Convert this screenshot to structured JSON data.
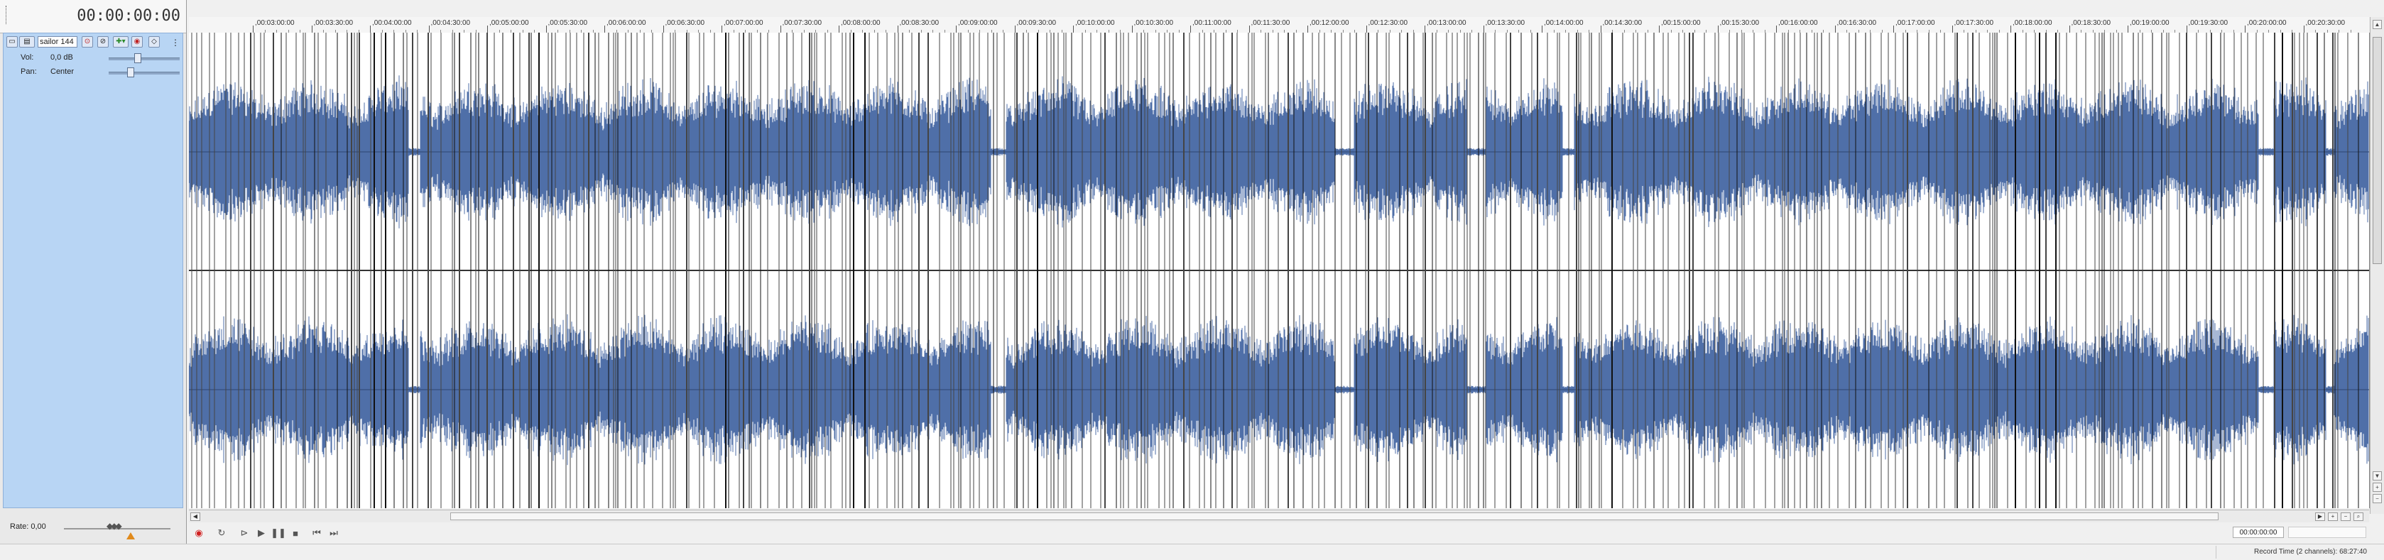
{
  "transport_time": "00:00:00:00",
  "track": {
    "name": "sailor 144",
    "volume_label": "Vol:",
    "volume_value": "0,0 dB",
    "pan_label": "Pan:",
    "pan_value": "Center"
  },
  "rate": {
    "label": "Rate:",
    "value": "0,00"
  },
  "ruler_labels": [
    "00:03:00:00",
    "00:03:30:00",
    "00:04:00:00",
    "00:04:30:00",
    "00:05:00:00",
    "00:05:30:00",
    "00:06:00:00",
    "00:06:30:00",
    "00:07:00:00",
    "00:07:30:00",
    "00:08:00:00",
    "00:08:30:00",
    "00:09:00:00",
    "00:09:30:00",
    "00:10:00:00",
    "00:10:30:00",
    "00:11:00:00",
    "00:11:30:00",
    "00:12:00:00",
    "00:12:30:00",
    "00:13:00:00",
    "00:13:30:00",
    "00:14:00:00",
    "00:14:30:00",
    "00:15:00:00",
    "00:15:30:00",
    "00:16:00:00",
    "00:16:30:00",
    "00:17:00:00",
    "00:17:30:00",
    "00:18:00:00",
    "00:18:30:00",
    "00:19:00:00",
    "00:19:30:00",
    "00:20:00:00",
    "00:20:30:00"
  ],
  "cursor_position": "00:00:00:00",
  "status": {
    "record_time": "Record Time (2 channels): 68:27:40"
  },
  "colors": {
    "waveform": "#4f6fa8",
    "track_header": "#b8d5f4",
    "record": "#d02020",
    "rate_marker": "#e08a1c"
  },
  "icons": {
    "track_header": [
      "track-options-icon",
      "track-fx-icon",
      "mute-icon",
      "solo-icon",
      "insert-fx-icon",
      "record-arm-icon",
      "automation-icon",
      "more-icon"
    ],
    "transport": [
      "record-icon",
      "loop-icon",
      "play-from-start-icon",
      "play-icon",
      "pause-icon",
      "stop-icon",
      "go-to-start-icon",
      "go-to-end-icon"
    ]
  }
}
